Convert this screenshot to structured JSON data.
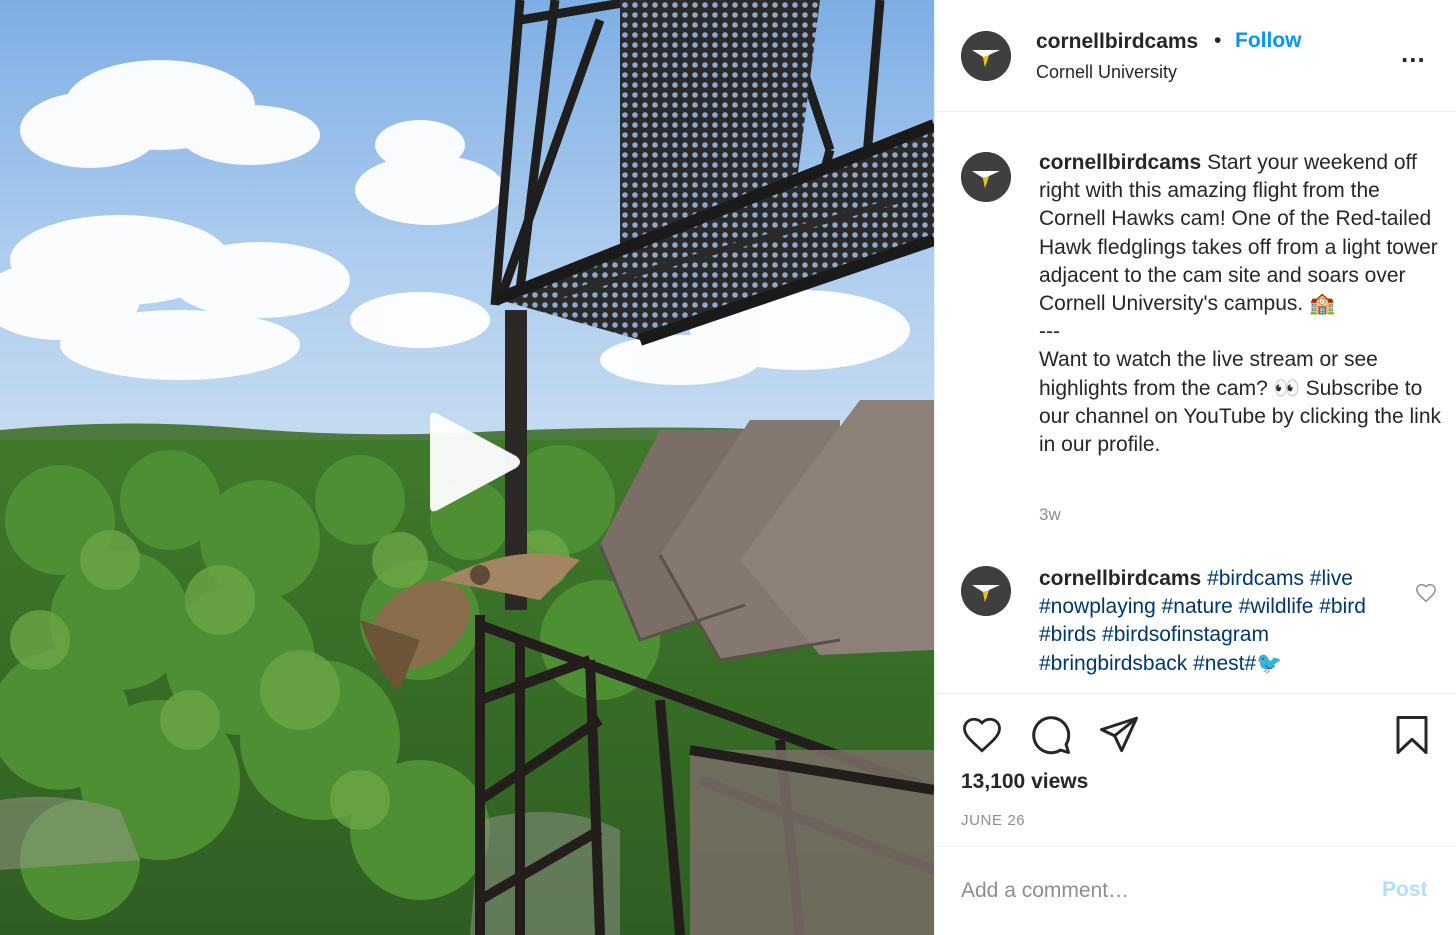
{
  "header": {
    "username": "cornellbirdcams",
    "separator": "•",
    "follow_label": "Follow",
    "location": "Cornell University",
    "more_label": "..."
  },
  "caption": {
    "username": "cornellbirdcams",
    "line1": "Start your weekend off right with this amazing flight from the Cornell Hawks cam! One of the Red-tailed Hawk fledglings takes off from a light tower adjacent to the cam site and soars over Cornell University's campus. 🏫",
    "divider": "---",
    "line2": "Want to watch the live stream or see highlights from the cam? 👀  Subscribe to our channel on YouTube by clicking the link in our profile.",
    "time_ago": "3w"
  },
  "second_comment": {
    "username": "cornellbirdcams",
    "hashtags": [
      "#birdcams",
      "#live",
      "#nowplaying",
      "#nature",
      "#wildlife",
      "#bird",
      "#birds",
      "#birdsofinstagram",
      "#bringbirdsback",
      "#nest",
      "#🐦"
    ]
  },
  "stats": {
    "views": "13,100 views",
    "date": "JUNE 26"
  },
  "comment_box": {
    "placeholder": "Add a comment…",
    "post_label": "Post"
  },
  "icons": {
    "like": "heart-icon",
    "comment": "comment-bubble-icon",
    "share": "paper-plane-icon",
    "save": "bookmark-icon",
    "play": "play-icon",
    "more": "more-options-icon"
  },
  "colors": {
    "link_blue": "#0095f6",
    "hashtag_blue": "#00376b",
    "muted_gray": "#8e8e8e",
    "post_disabled": "#b2dffc",
    "avatar_bg": "#3f3f3f"
  }
}
